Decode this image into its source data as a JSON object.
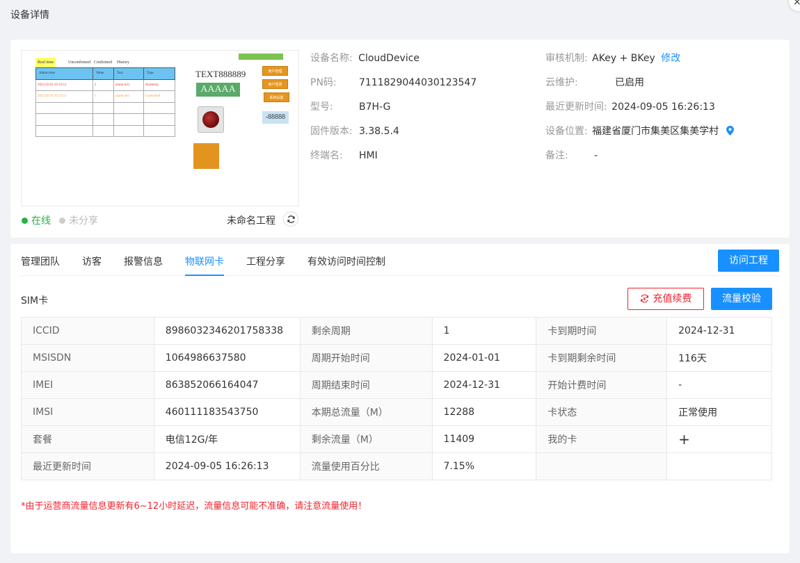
{
  "window": {
    "title": "设备详情",
    "close_glyph": "×"
  },
  "preview": {
    "tabs": [
      "Real time",
      "Unconfirmed",
      "Confirmed",
      "History"
    ],
    "table_headers": [
      "Alarm time",
      "Value",
      "Text",
      "Type"
    ],
    "rows": [
      [
        "2023.02.03 16:33:51",
        "2",
        "alarm text",
        "Alarmtyp"
      ],
      [
        "2023.02.03 16:33:51",
        "1",
        "alarm text",
        "Confirmed"
      ]
    ],
    "text_label": "TEXT888889",
    "aaaaa_label": "AAAAA",
    "buttons": [
      "用户管理",
      "用户登录",
      "系统设置"
    ],
    "number_display": "-88888"
  },
  "status": {
    "online": "在线",
    "share": "未分享"
  },
  "project_name": "未命名工程",
  "device_info": {
    "left": [
      {
        "label": "设备名称:",
        "value": "CloudDevice"
      },
      {
        "label": "PN码:",
        "value": "7111829044030123547"
      },
      {
        "label": "型号:",
        "value": "B7H-G"
      },
      {
        "label": "固件版本:",
        "value": "3.38.5.4"
      },
      {
        "label": "终端名:",
        "value": "HMI"
      }
    ],
    "right": [
      {
        "label": "审核机制:",
        "value": "AKey + BKey",
        "link": "修改"
      },
      {
        "label": "云维护:",
        "value": "已启用"
      },
      {
        "label": "最近更新时间:",
        "value": "2024-09-05 16:26:13"
      },
      {
        "label": "设备位置:",
        "value": "福建省厦门市集美区集美学村"
      },
      {
        "label": "备注:",
        "value": "-"
      }
    ]
  },
  "tabs": [
    "管理团队",
    "访客",
    "报警信息",
    "物联网卡",
    "工程分享",
    "有效访问时间控制"
  ],
  "active_tab": "物联网卡",
  "visit_button": "访问工程",
  "sim": {
    "title": "SIM卡",
    "recharge_button": "充值续费",
    "check_button": "流量校验",
    "rows": [
      [
        "ICCID",
        "8986032346201758338",
        "剩余周期",
        "1",
        "卡到期时间",
        "2024-12-31"
      ],
      [
        "MSISDN",
        "1064986637580",
        "周期开始时间",
        "2024-01-01",
        "卡到期剩余时间",
        "116天"
      ],
      [
        "IMEI",
        "863852066164047",
        "周期结束时间",
        "2024-12-31",
        "开始计费时间",
        "-"
      ],
      [
        "IMSI",
        "460111183543750",
        "本期总流量（M）",
        "12288",
        "卡状态",
        "正常使用"
      ],
      [
        "套餐",
        "电信12G/年",
        "剩余流量（M）",
        "11409",
        "我的卡",
        "+"
      ],
      [
        "最近更新时间",
        "2024-09-05 16:26:13",
        "流量使用百分比",
        "7.15%",
        "",
        ""
      ]
    ],
    "note": "*由于运营商流量信息更新有6~12小时延迟，流量信息可能不准确，请注意流量使用！"
  },
  "colors": {
    "accent": "#1890ff",
    "online": "#27b148",
    "danger": "#f5222d"
  }
}
